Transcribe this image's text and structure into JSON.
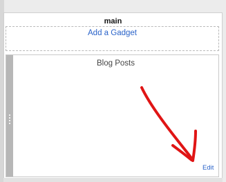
{
  "layout": {
    "section_title": "main"
  },
  "add_gadget": {
    "label": "Add a Gadget"
  },
  "gadget": {
    "title": "Blog Posts",
    "edit_label": "Edit"
  },
  "colors": {
    "link": "#2a63c9",
    "annotation": "#e01515",
    "handle": "#b7b7b7"
  },
  "icons": {
    "drag_handle": "drag-grip-icon",
    "annotation": "red-arrow-icon"
  }
}
